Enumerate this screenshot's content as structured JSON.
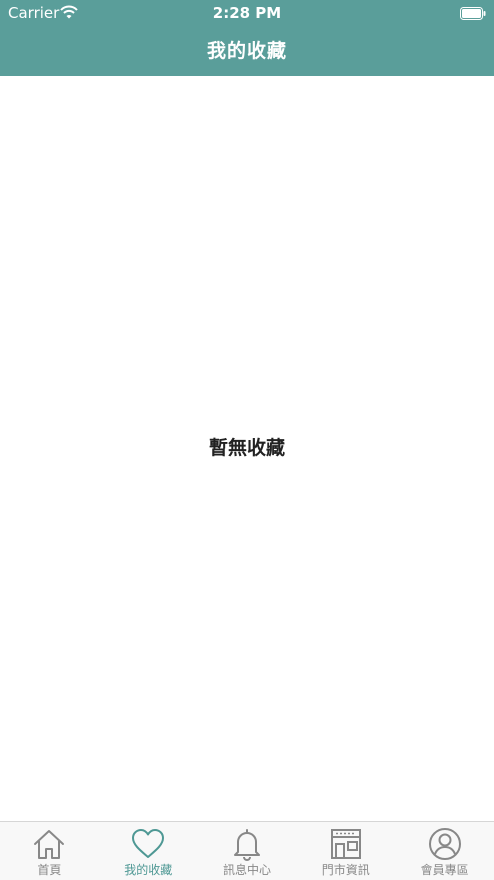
{
  "status_bar": {
    "carrier": "Carrier",
    "time": "2:28 PM"
  },
  "nav": {
    "title": "我的收藏"
  },
  "content": {
    "empty_message": "暫無收藏"
  },
  "tabs": [
    {
      "label": "首頁",
      "icon": "home-icon",
      "active": false
    },
    {
      "label": "我的收藏",
      "icon": "heart-icon",
      "active": true
    },
    {
      "label": "訊息中心",
      "icon": "bell-icon",
      "active": false
    },
    {
      "label": "門市資訊",
      "icon": "store-icon",
      "active": false
    },
    {
      "label": "會員專區",
      "icon": "user-icon",
      "active": false
    }
  ],
  "colors": {
    "header": "#5a9e9a",
    "active_tab": "#4e9894",
    "inactive_tab": "#888888"
  }
}
